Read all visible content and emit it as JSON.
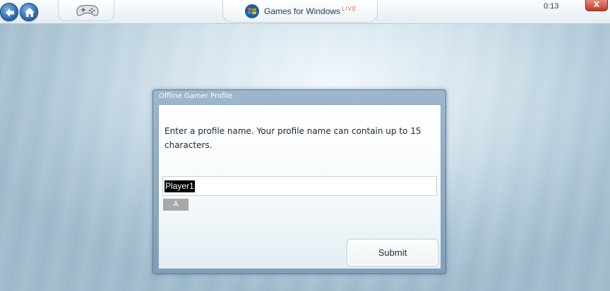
{
  "topbar": {
    "back_icon": "back-arrow-icon",
    "home_icon": "home-icon",
    "controller_icon": "gamepad-icon",
    "brand_logo_icon": "windows-logo-icon",
    "brand_text": "Games for Windows",
    "brand_live": "LIVE",
    "clock": "0:13",
    "close_label": "X"
  },
  "dialog": {
    "title": "Offline Gamer Profile",
    "prompt": "Enter a profile name. Your profile name can contain up to 15 characters.",
    "input_value": "Player1",
    "keyboard_hint": "A",
    "submit_label": "Submit"
  },
  "colors": {
    "accent_blue": "#2c6fb6",
    "close_red": "#c23a23",
    "live_orange": "#e06a2a",
    "dialog_frame": "#8fabc2"
  }
}
